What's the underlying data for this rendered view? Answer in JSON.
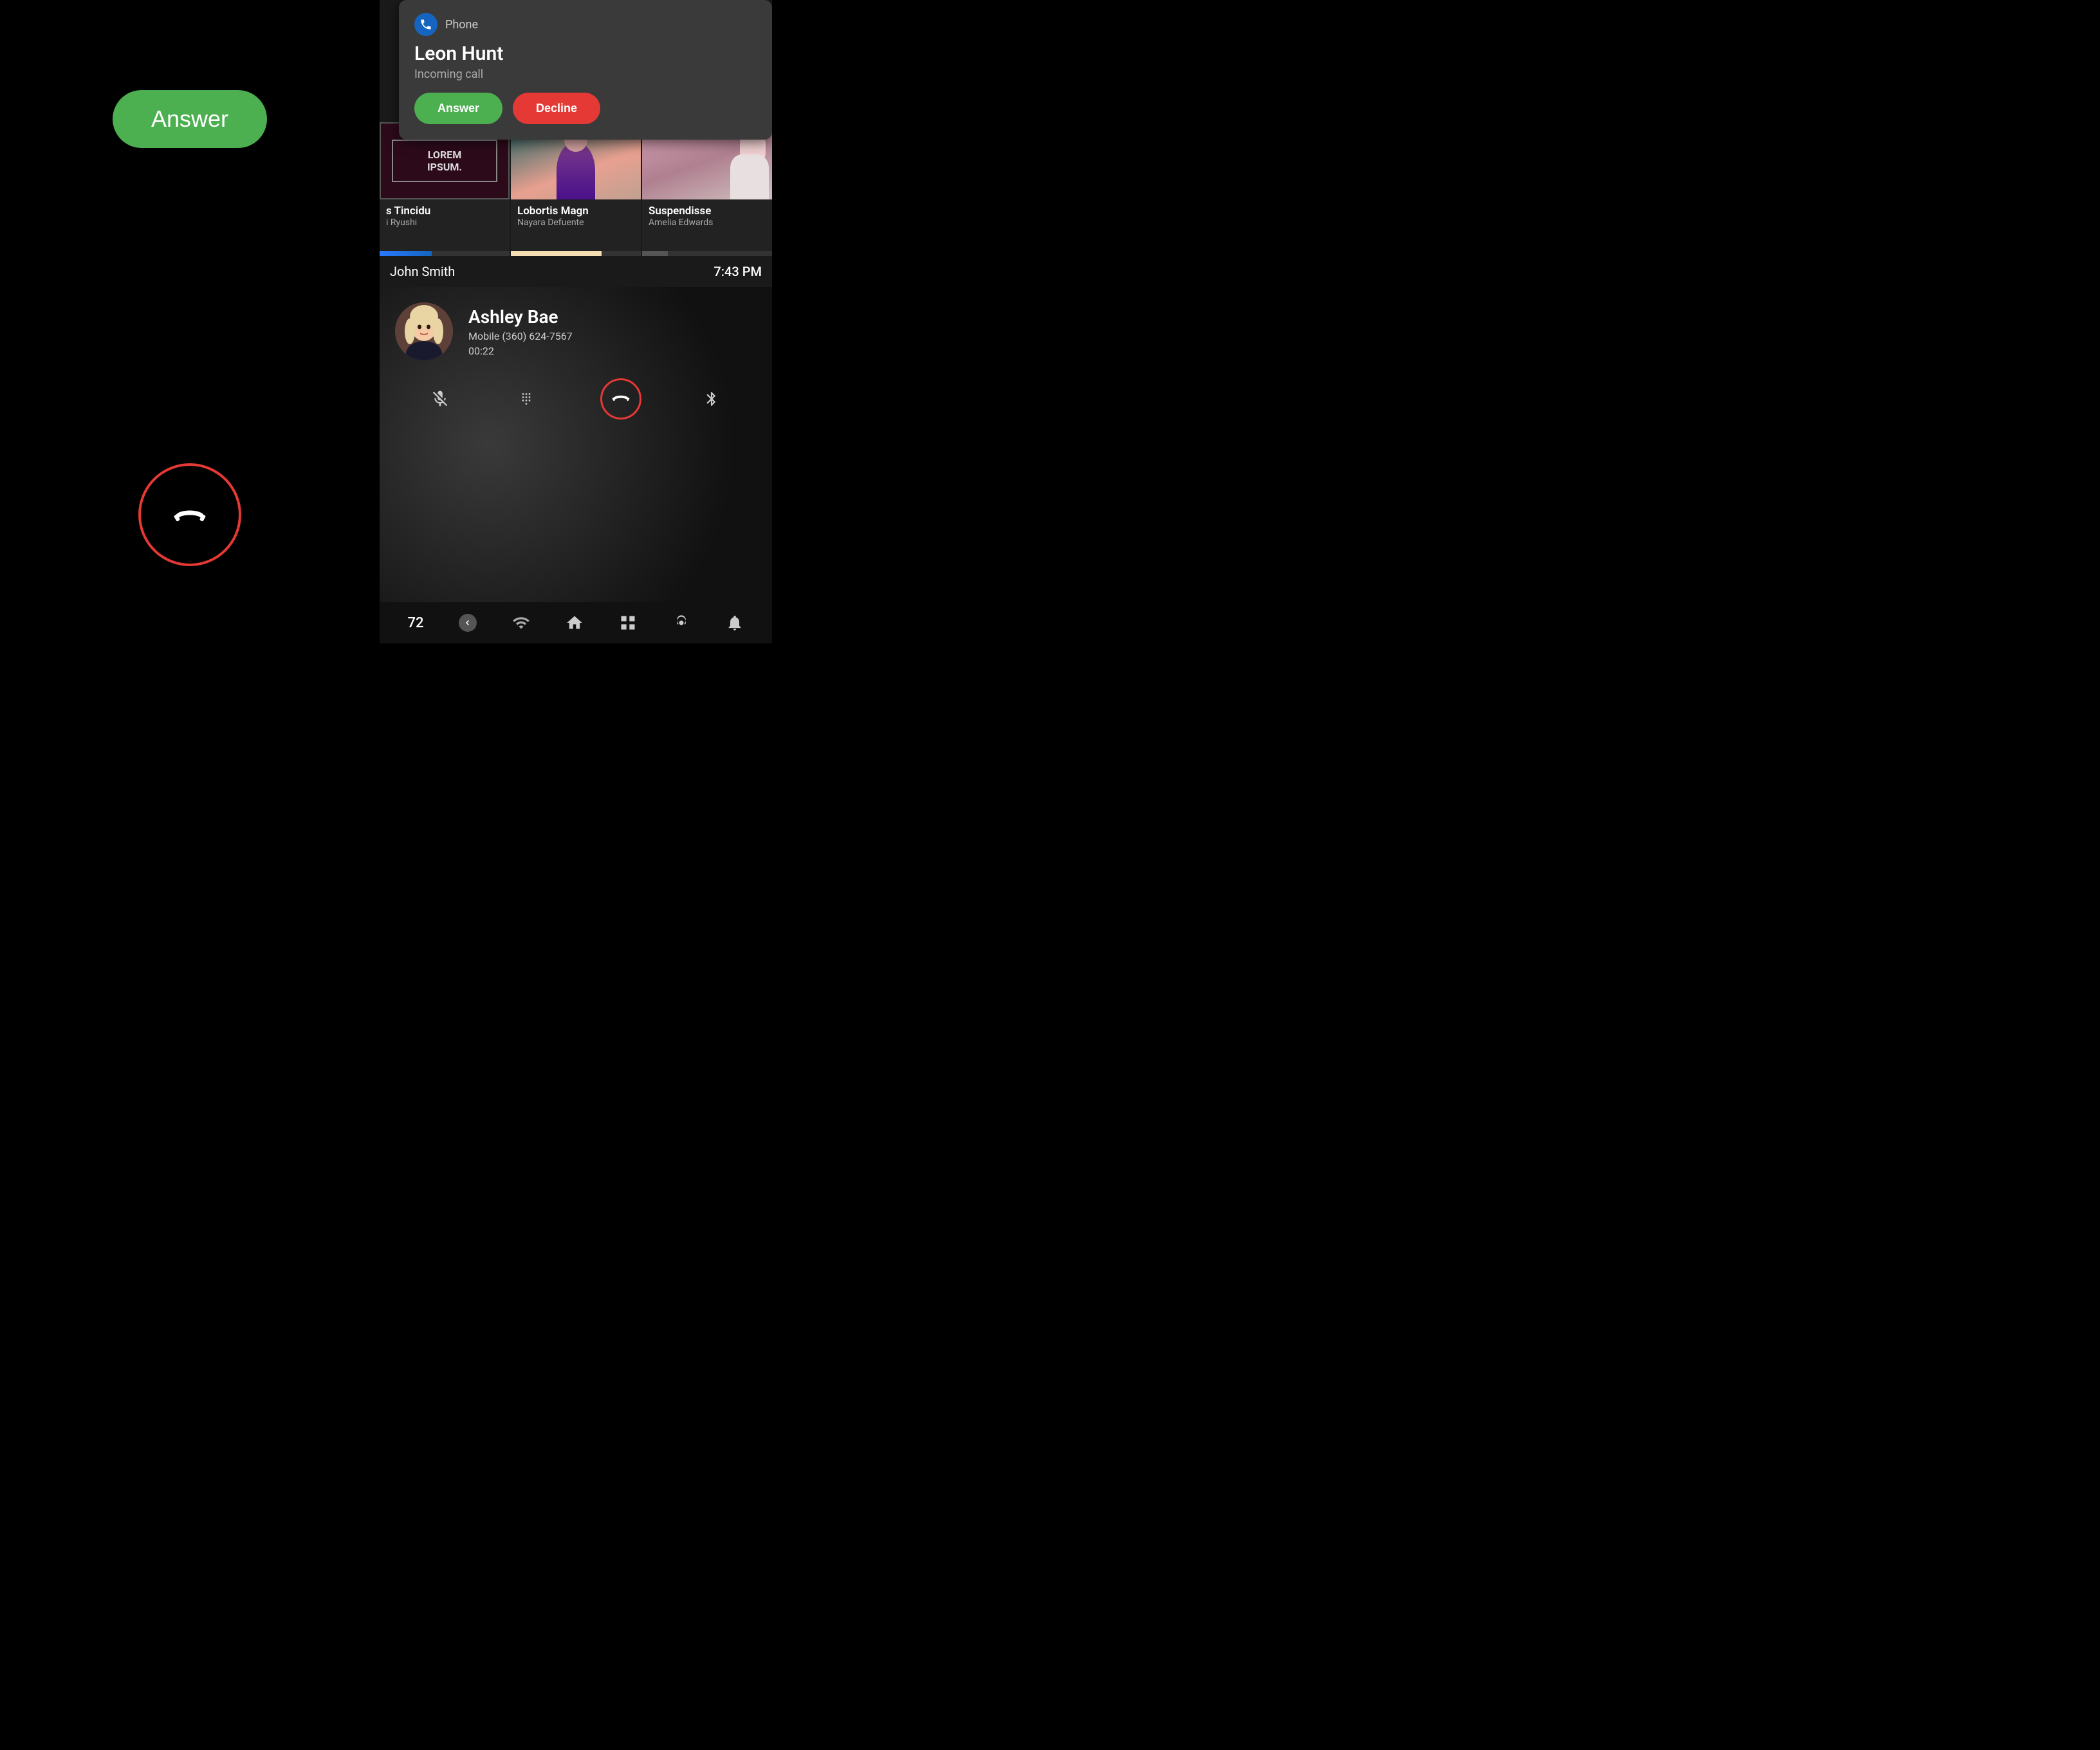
{
  "left_panel": {
    "answer_button_label": "Answer",
    "end_call_icon": "☎"
  },
  "notification": {
    "app_label": "Phone",
    "caller_name": "Leon Hunt",
    "call_status": "Incoming call",
    "answer_label": "Answer",
    "decline_label": "Decline"
  },
  "content_cards": [
    {
      "title": "s Tincidu",
      "subtitle": "i Ryushi",
      "thumb_type": "lorem"
    },
    {
      "title": "Lobortis Magn",
      "subtitle": "Nayara Defuente",
      "thumb_type": "teal"
    },
    {
      "title": "Suspendisse",
      "subtitle": "Amelia Edwards",
      "thumb_type": "pink"
    }
  ],
  "john_smith": {
    "name": "John Smith",
    "time": "7:43 PM"
  },
  "active_call": {
    "caller_name": "Ashley Bae",
    "caller_number": "Mobile (360) 624-7567",
    "duration": "00:22"
  },
  "bottom_bar": {
    "temperature": "72",
    "home_icon": "⌂",
    "grid_icon": "⋯",
    "fan_icon": "✦",
    "bell_icon": "🔔"
  }
}
